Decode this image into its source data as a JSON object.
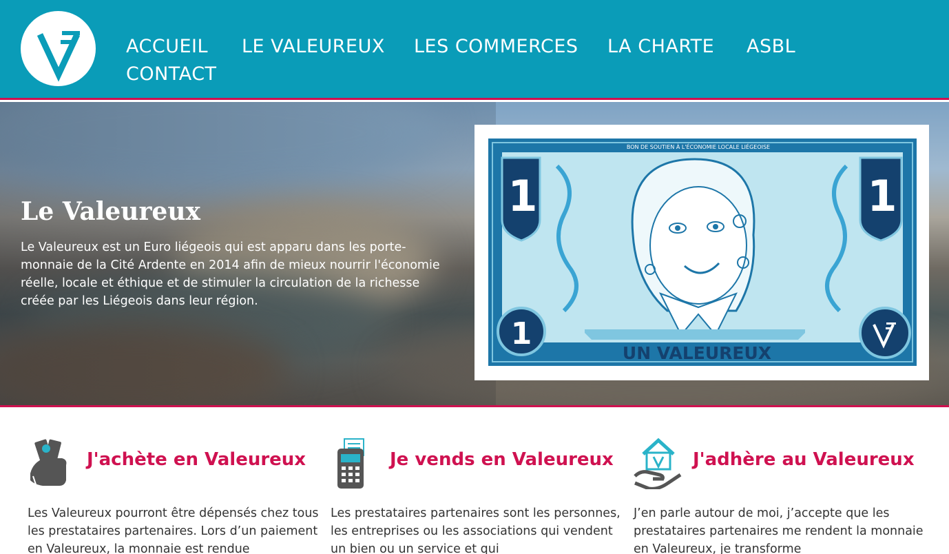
{
  "colors": {
    "header_bg": "#0a9cb8",
    "accent": "#cf1150",
    "note_blue": "#1d76a8",
    "note_light": "#bfe5f0"
  },
  "header": {
    "logo_icon": "valeureux-v-logo-icon",
    "nav": [
      {
        "label": "ACCUEIL"
      },
      {
        "label": "LE VALEUREUX"
      },
      {
        "label": "LES COMMERCES"
      },
      {
        "label": "LA CHARTE"
      },
      {
        "label": "ASBL"
      },
      {
        "label": "CONTACT"
      }
    ]
  },
  "hero": {
    "title": "Le Valeureux",
    "text": "Le Valeureux est un Euro liégeois qui est apparu dans les porte-monnaie de la Cité Ardente en 2014 afin de mieux nourrir l'économie réelle, locale et éthique et de stimuler la circulation de la richesse créée par les Liégeois dans leur région.",
    "banknote": {
      "top_text": "BON DE SOUTIEN À L'ÉCONOMIE LOCALE LIÉGEOISE",
      "denomination": "1",
      "name": "UN VALEUREUX"
    }
  },
  "features": [
    {
      "icon": "hand-with-banknotes-icon",
      "title": "J'achète en Valeureux",
      "text": "Les Valeureux pourront être dépensés chez tous les prestataires partenaires. Lors d’un paiement en Valeureux, la monnaie est rendue"
    },
    {
      "icon": "payment-terminal-icon",
      "title": "Je vends en Valeureux",
      "text": "Les prestataires partenaires sont les personnes, les entreprises ou les associations qui vendent un bien ou un service et qui"
    },
    {
      "icon": "hand-with-house-icon",
      "title": "J'adhère au Valeureux",
      "text": "J’en parle autour de moi, j’accepte que les prestataires partenaires me rendent la monnaie en Valeureux, je transforme"
    }
  ]
}
